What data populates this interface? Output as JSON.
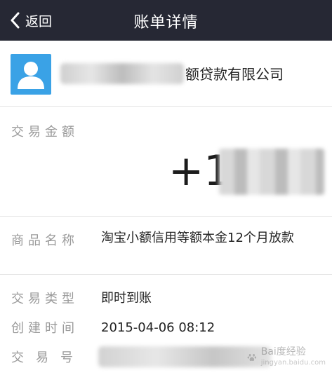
{
  "topbar": {
    "back_label": "返回",
    "title": "账单详情"
  },
  "header": {
    "company_suffix": "额贷款有限公司"
  },
  "amount": {
    "label": "交易金额",
    "value_prefix": "+1"
  },
  "product": {
    "label": "商品名称",
    "value": "淘宝小额信用等额本金12个月放款"
  },
  "transaction_type": {
    "label": "交易类型",
    "value": "即时到账"
  },
  "created_time": {
    "label": "创建时间",
    "value": "2015-04-06 08:12"
  },
  "transaction_no": {
    "label": "交易号"
  },
  "watermark": {
    "text": "Bai度经验",
    "subtext": "jingyan.baidu.com"
  },
  "colors": {
    "topbar_bg": "#262834",
    "avatar_blue": "#3aa2e6",
    "label_gray": "#9a9a9a"
  }
}
